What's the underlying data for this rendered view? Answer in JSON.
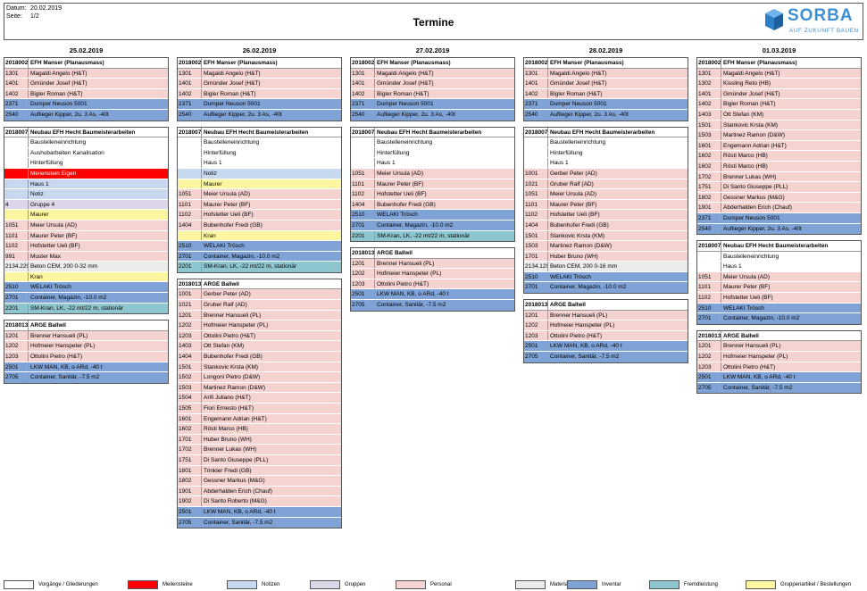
{
  "header": {
    "date_label": "Datum:",
    "date_value": "20.02.2019",
    "page_label": "Seite:",
    "page_value": "1/2",
    "title": "Termine",
    "logo_text": "SORBA",
    "logo_tagline": "AUF ZUKUNFT BAUEN"
  },
  "colors": {
    "w": "#ffffff",
    "p": "#f4d3d1",
    "i": "#7fa3d6",
    "n": "#c8d9ef",
    "g": "#ddd6e8",
    "y": "#fdf6a0",
    "m": "#ebebeb",
    "f": "#8ec6cf",
    "r": "#ff0000"
  },
  "days": [
    {
      "date": "25.02.2019",
      "projects": [
        {
          "code": "2018002",
          "name": "EFH Manser (Planausmass)",
          "rows": [
            [
              "1301",
              "Magaldi Angelo (H&T)",
              "p"
            ],
            [
              "1401",
              "Gmünder Josef (H&T)",
              "p"
            ],
            [
              "1402",
              "Bigler Roman (H&T)",
              "p"
            ],
            [
              "2371",
              "Dumper Neuson 5001",
              "i"
            ],
            [
              "2540",
              "Auflieger Kipper, 2u. 3 As, -40t",
              "i"
            ]
          ]
        },
        {
          "code": "2018007",
          "name": "Neubau EFH Hecht Baumeisterarbeiten",
          "rows": [
            [
              "",
              "Baustelleneinrichtung",
              "w"
            ],
            [
              "",
              "Aushubarbeiten Kanalisation",
              "w"
            ],
            [
              "",
              "Hinterfüllung",
              "w"
            ],
            [
              "",
              "Meilenstein Eigen",
              "r"
            ],
            [
              "",
              "Haus 1",
              "n"
            ],
            [
              "",
              "Notiz",
              "n"
            ],
            [
              "4",
              "Gruppe 4",
              "g"
            ],
            [
              "",
              "Maurer",
              "y"
            ],
            [
              "1051",
              "Meier Ursula (AD)",
              "p"
            ],
            [
              "1101",
              "Maurer Peter (BF)",
              "p"
            ],
            [
              "1102",
              "Hofstetter Ueli (BF)",
              "p"
            ],
            [
              "991",
              "Muster Max",
              "p"
            ],
            [
              "2134.229",
              "Beton CEM, 200 0-32 mm",
              "m"
            ],
            [
              "",
              "Kran",
              "y"
            ],
            [
              "2510",
              "WELAKI Trösch",
              "i"
            ],
            [
              "2701",
              "Container, Magazin, -10.0 m2",
              "i"
            ],
            [
              "2201",
              "SM-Kran, LK, -22 mt/22 m, stationär",
              "f"
            ]
          ]
        },
        {
          "code": "2018013",
          "name": "ARGE Ballwil",
          "rows": [
            [
              "1201",
              "Brenner Hansueli (PL)",
              "p"
            ],
            [
              "1202",
              "Hofmeier Hanspeter (PL)",
              "p"
            ],
            [
              "1203",
              "Ottolini Pietro (H&T)",
              "p"
            ],
            [
              "2501",
              "LKW MAN, KB, o ARd, -40 t",
              "i"
            ],
            [
              "2705",
              "Container, Sanitär,  -7.5 m2",
              "i"
            ]
          ]
        }
      ]
    },
    {
      "date": "26.02.2019",
      "projects": [
        {
          "code": "2018002",
          "name": "EFH Manser (Planausmass)",
          "rows": [
            [
              "1301",
              "Magaldi Angelo (H&T)",
              "p"
            ],
            [
              "1401",
              "Gmünder Josef (H&T)",
              "p"
            ],
            [
              "1402",
              "Bigler Roman (H&T)",
              "p"
            ],
            [
              "2371",
              "Dumper Neuson 5001",
              "i"
            ],
            [
              "2540",
              "Auflieger Kipper, 2u. 3 As, -40t",
              "i"
            ]
          ]
        },
        {
          "code": "2018007",
          "name": "Neubau EFH Hecht Baumeisterarbeiten",
          "rows": [
            [
              "",
              "Baustelleneinrichtung",
              "w"
            ],
            [
              "",
              "Hinterfüllung",
              "w"
            ],
            [
              "",
              "Haus 1",
              "w"
            ],
            [
              "",
              "Notiz",
              "n"
            ],
            [
              "",
              "Maurer",
              "y"
            ],
            [
              "1051",
              "Meier Ursula (AD)",
              "p"
            ],
            [
              "1101",
              "Maurer Peter (BF)",
              "p"
            ],
            [
              "1102",
              "Hofstetter Ueli (BF)",
              "p"
            ],
            [
              "1404",
              "Bubenhofer Fredi (GB)",
              "p"
            ],
            [
              "",
              "Kran",
              "y"
            ],
            [
              "2510",
              "WELAKI Trösch",
              "i"
            ],
            [
              "2701",
              "Container, Magazin, -10.0 m2",
              "i"
            ],
            [
              "2201",
              "SM-Kran, LK, -22 mt/22 m, stationär",
              "f"
            ]
          ]
        },
        {
          "code": "2018013",
          "name": "ARGE Ballwil",
          "rows": [
            [
              "1001",
              "Gerber Peter (AD)",
              "p"
            ],
            [
              "1021",
              "Gruber Ralf (AD)",
              "p"
            ],
            [
              "1201",
              "Brenner Hansueli (PL)",
              "p"
            ],
            [
              "1202",
              "Hofmeier Hanspeter (PL)",
              "p"
            ],
            [
              "1203",
              "Ottolini Pietro (H&T)",
              "p"
            ],
            [
              "1403",
              "Ott Stefan (KM)",
              "p"
            ],
            [
              "1404",
              "Bubenhofer Fredi (GB)",
              "p"
            ],
            [
              "1501",
              "Stankovic Krsta (KM)",
              "p"
            ],
            [
              "1502",
              "Longoni Pietro (D&W)",
              "p"
            ],
            [
              "1503",
              "Martinez Ramon (D&W)",
              "p"
            ],
            [
              "1504",
              "Arifi Juliano (H&T)",
              "p"
            ],
            [
              "1505",
              "Fiori Ernesto (H&T)",
              "p"
            ],
            [
              "1601",
              "Engemann Adrian (H&T)",
              "p"
            ],
            [
              "1602",
              "Rösti Marco (HB)",
              "p"
            ],
            [
              "1701",
              "Huber Bruno (WH)",
              "p"
            ],
            [
              "1702",
              "Brenner Lukas (WH)",
              "p"
            ],
            [
              "1751",
              "Di Santo Giuseppe (PLL)",
              "p"
            ],
            [
              "1801",
              "Trinkler Fredi (GB)",
              "p"
            ],
            [
              "1802",
              "Gessner Markus (M&G)",
              "p"
            ],
            [
              "1901",
              "Abderhalden Erich (Chauf)",
              "p"
            ],
            [
              "1902",
              "Di Santo Roberto (M&G)",
              "p"
            ],
            [
              "2501",
              "LKW MAN, KB, o ARd, -40 t",
              "i"
            ],
            [
              "2705",
              "Container, Sanitär,  -7.5 m2",
              "i"
            ]
          ]
        }
      ]
    },
    {
      "date": "27.02.2019",
      "projects": [
        {
          "code": "2018002",
          "name": "EFH Manser (Planausmass)",
          "rows": [
            [
              "1301",
              "Magaldi Angelo (H&T)",
              "p"
            ],
            [
              "1401",
              "Gmünder Josef (H&T)",
              "p"
            ],
            [
              "1402",
              "Bigler Roman (H&T)",
              "p"
            ],
            [
              "2371",
              "Dumper Neuson 5001",
              "i"
            ],
            [
              "2540",
              "Auflieger Kipper, 2u. 3 As, -40t",
              "i"
            ]
          ]
        },
        {
          "code": "2018007",
          "name": "Neubau EFH Hecht Baumeisterarbeiten",
          "rows": [
            [
              "",
              "Baustelleneinrichtung",
              "w"
            ],
            [
              "",
              "Hinterfüllung",
              "w"
            ],
            [
              "",
              "Haus 1",
              "w"
            ],
            [
              "1051",
              "Meier Ursula (AD)",
              "p"
            ],
            [
              "1101",
              "Maurer Peter (BF)",
              "p"
            ],
            [
              "1102",
              "Hofstetter Ueli (BF)",
              "p"
            ],
            [
              "1404",
              "Bubenhofer Fredi (GB)",
              "p"
            ],
            [
              "2510",
              "WELAKI Trösch",
              "i"
            ],
            [
              "2701",
              "Container, Magazin, -10.0 m2",
              "i"
            ],
            [
              "2201",
              "SM-Kran, LK, -22 mt/22 m, stationär",
              "f"
            ]
          ]
        },
        {
          "code": "2018013",
          "name": "ARGE Ballwil",
          "rows": [
            [
              "1201",
              "Brenner Hansueli (PL)",
              "p"
            ],
            [
              "1202",
              "Hofmeier Hanspeter (PL)",
              "p"
            ],
            [
              "1203",
              "Ottolini Pietro (H&T)",
              "p"
            ],
            [
              "2501",
              "LKW MAN, KB, o ARd, -40 t",
              "i"
            ],
            [
              "2705",
              "Container, Sanitär,  -7.5 m2",
              "i"
            ]
          ]
        }
      ]
    },
    {
      "date": "28.02.2019",
      "projects": [
        {
          "code": "2018002",
          "name": "EFH Manser (Planausmass)",
          "rows": [
            [
              "1301",
              "Magaldi Angelo (H&T)",
              "p"
            ],
            [
              "1401",
              "Gmünder Josef (H&T)",
              "p"
            ],
            [
              "1402",
              "Bigler Roman (H&T)",
              "p"
            ],
            [
              "2371",
              "Dumper Neuson 5001",
              "i"
            ],
            [
              "2540",
              "Auflieger Kipper, 2u. 3 As, -40t",
              "i"
            ]
          ]
        },
        {
          "code": "2018007",
          "name": "Neubau EFH Hecht Baumeisterarbeiten",
          "rows": [
            [
              "",
              "Baustelleneinrichtung",
              "w"
            ],
            [
              "",
              "Hinterfüllung",
              "w"
            ],
            [
              "",
              "Haus 1",
              "w"
            ],
            [
              "1001",
              "Gerber Peter (AD)",
              "p"
            ],
            [
              "1021",
              "Gruber Ralf (AD)",
              "p"
            ],
            [
              "1051",
              "Meier Ursula (AD)",
              "p"
            ],
            [
              "1101",
              "Maurer Peter (BF)",
              "p"
            ],
            [
              "1102",
              "Hofstetter Ueli (BF)",
              "p"
            ],
            [
              "1404",
              "Bubenhofer Fredi (GB)",
              "p"
            ],
            [
              "1501",
              "Stankovic Krsta (KM)",
              "p"
            ],
            [
              "1503",
              "Martinez Ramon (D&W)",
              "p"
            ],
            [
              "1701",
              "Huber Bruno (WH)",
              "p"
            ],
            [
              "2134.129",
              "Beton CEM, 200 0-16 mm",
              "m"
            ],
            [
              "2510",
              "WELAKI Trösch",
              "i"
            ],
            [
              "2701",
              "Container, Magazin, -10.0 m2",
              "i"
            ]
          ]
        },
        {
          "code": "2018013",
          "name": "ARGE Ballwil",
          "rows": [
            [
              "1201",
              "Brenner Hansueli (PL)",
              "p"
            ],
            [
              "1202",
              "Hofmeier Hanspeter (PL)",
              "p"
            ],
            [
              "1203",
              "Ottolini Pietro (H&T)",
              "p"
            ],
            [
              "2501",
              "LKW MAN, KB, o ARd, -40 t",
              "i"
            ],
            [
              "2705",
              "Container, Sanitär,  -7.5 m2",
              "i"
            ]
          ]
        }
      ]
    },
    {
      "date": "01.03.2019",
      "projects": [
        {
          "code": "2018002",
          "name": "EFH Manser (Planausmass)",
          "rows": [
            [
              "1301",
              "Magaldi Angelo (H&T)",
              "p"
            ],
            [
              "1302",
              "Kissling Reto (HB)",
              "p"
            ],
            [
              "1401",
              "Gmünder Josef (H&T)",
              "p"
            ],
            [
              "1402",
              "Bigler Roman (H&T)",
              "p"
            ],
            [
              "1403",
              "Ott Stefan (KM)",
              "p"
            ],
            [
              "1501",
              "Stankovic Krsta (KM)",
              "p"
            ],
            [
              "1503",
              "Martinez Ramon (D&W)",
              "p"
            ],
            [
              "1601",
              "Engemann Adrian (H&T)",
              "p"
            ],
            [
              "1602",
              "Rösti Marco (HB)",
              "p"
            ],
            [
              "1602",
              "Rösti Marco (HB)",
              "p"
            ],
            [
              "1702",
              "Brenner Lukas (WH)",
              "p"
            ],
            [
              "1751",
              "Di Santo Giuseppe (PLL)",
              "p"
            ],
            [
              "1802",
              "Gessner Markus (M&G)",
              "p"
            ],
            [
              "1901",
              "Abderhalden Erich (Chauf)",
              "p"
            ],
            [
              "2371",
              "Dumper Neuson 5001",
              "i"
            ],
            [
              "2540",
              "Auflieger Kipper, 2u. 3 As, -40t",
              "i"
            ]
          ]
        },
        {
          "code": "2018007",
          "name": "Neubau EFH Hecht Baumeisterarbeiten",
          "rows": [
            [
              "",
              "Baustelleneinrichtung",
              "w"
            ],
            [
              "",
              "Haus 1",
              "w"
            ],
            [
              "1051",
              "Meier Ursula (AD)",
              "p"
            ],
            [
              "1101",
              "Maurer Peter (BF)",
              "p"
            ],
            [
              "1102",
              "Hofstetter Ueli (BF)",
              "p"
            ],
            [
              "2510",
              "WELAKI Trösch",
              "i"
            ],
            [
              "2701",
              "Container, Magazin, -10.0 m2",
              "i"
            ]
          ]
        },
        {
          "code": "2018013",
          "name": "ARGE Ballwil",
          "rows": [
            [
              "1201",
              "Brenner Hansueli (PL)",
              "p"
            ],
            [
              "1202",
              "Hofmeier Hanspeter (PL)",
              "p"
            ],
            [
              "1203",
              "Ottolini Pietro (H&T)",
              "p"
            ],
            [
              "2501",
              "LKW MAN, KB, o ARd, -40 t",
              "i"
            ],
            [
              "2705",
              "Container, Sanitär,  -7.5 m2",
              "i"
            ]
          ]
        }
      ]
    }
  ],
  "legend": [
    {
      "label": "Vorgänge / Gliederungen",
      "color": "#ffffff"
    },
    {
      "label": "Meilensteine",
      "color": "#ff0000"
    },
    {
      "label": "Notizen",
      "color": "#c8d9ef"
    },
    {
      "label": "Gruppen",
      "color": "#ddd6e8"
    },
    {
      "label": "Personal",
      "color": "#f4d3d1"
    },
    {
      "label": "Material",
      "color": "#ebebeb"
    },
    {
      "label": "Inventar",
      "color": "#7fa3d6"
    },
    {
      "label": "Fremdleistung",
      "color": "#8ec6cf"
    },
    {
      "label": "Gruppenartikel / Bestellungen",
      "color": "#fdf6a0"
    }
  ]
}
